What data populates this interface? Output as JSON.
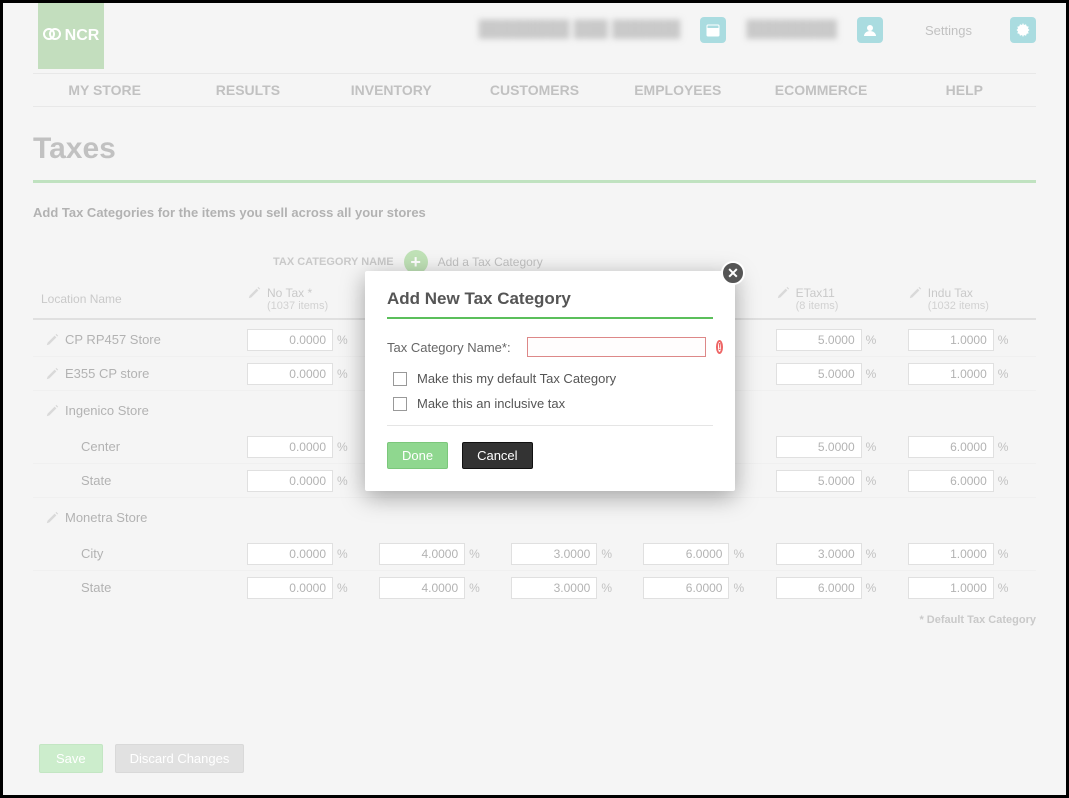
{
  "brand": {
    "name": "NCR"
  },
  "header": {
    "settings": "Settings"
  },
  "nav": {
    "mystore": "MY STORE",
    "results": "RESULTS",
    "inventory": "INVENTORY",
    "customers": "CUSTOMERS",
    "employees": "EMPLOYEES",
    "ecommerce": "ECOMMERCE",
    "help": "HELP"
  },
  "page": {
    "title": "Taxes",
    "subhead": "Add Tax Categories for the items you sell across all your stores"
  },
  "addcat": {
    "label": "TAX CATEGORY NAME",
    "link": "Add a Tax Category"
  },
  "columns": {
    "loc": "Location Name",
    "c1": {
      "name": "No Tax *",
      "items": "(1037 items)"
    },
    "c5": {
      "name": "ETax11",
      "items": "(8 items)"
    },
    "c6": {
      "name": "Indu Tax",
      "items": "(1032 items)"
    }
  },
  "rows": [
    {
      "type": "data",
      "label": "CP RP457 Store",
      "vals": [
        "0.0000",
        "",
        "",
        "",
        "5.0000",
        "1.0000"
      ],
      "edit": true,
      "top": true
    },
    {
      "type": "data",
      "label": "E355 CP store",
      "vals": [
        "0.0000",
        "",
        "",
        "",
        "5.0000",
        "1.0000"
      ],
      "edit": true,
      "sep": true
    },
    {
      "type": "group",
      "label": "Ingenico Store"
    },
    {
      "type": "data",
      "label": "Center",
      "child": true,
      "vals": [
        "0.0000",
        "",
        "",
        "",
        "5.0000",
        "6.0000"
      ]
    },
    {
      "type": "data",
      "label": "State",
      "child": true,
      "vals": [
        "0.0000",
        "",
        "",
        "",
        "5.0000",
        "6.0000"
      ],
      "sep": true
    },
    {
      "type": "group",
      "label": "Monetra Store"
    },
    {
      "type": "data",
      "label": "City",
      "child": true,
      "vals": [
        "0.0000",
        "4.0000",
        "3.0000",
        "6.0000",
        "3.0000",
        "1.0000"
      ]
    },
    {
      "type": "data",
      "label": "State",
      "child": true,
      "vals": [
        "0.0000",
        "4.0000",
        "3.0000",
        "6.0000",
        "6.0000",
        "1.0000"
      ],
      "sep": true
    }
  ],
  "footnote": "* Default Tax Category",
  "footer": {
    "save": "Save",
    "discard": "Discard Changes"
  },
  "modal": {
    "title": "Add New Tax Category",
    "name_label": "Tax Category Name*:",
    "name_value": "",
    "opt_default": "Make this my default Tax Category",
    "opt_inclusive": "Make this an inclusive tax",
    "done": "Done",
    "cancel": "Cancel"
  }
}
